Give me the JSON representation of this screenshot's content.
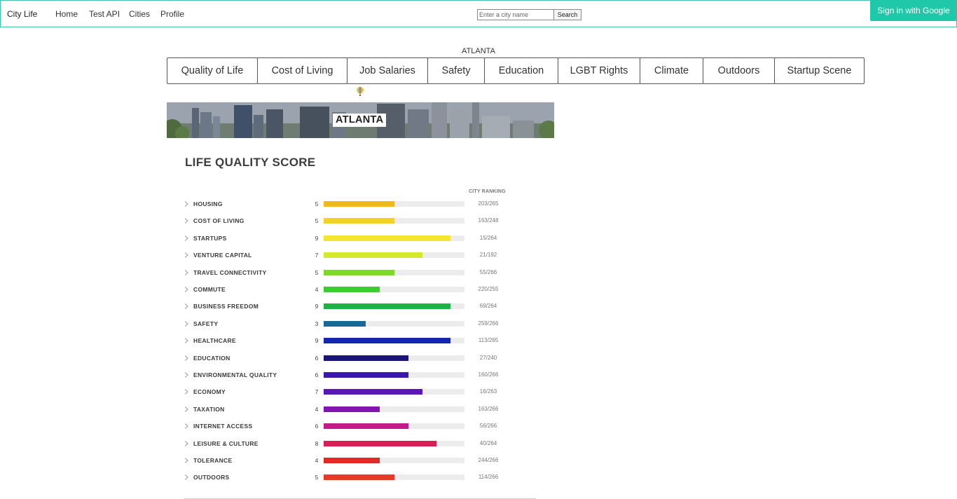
{
  "nav": {
    "brand": "City Life",
    "links": [
      "Home",
      "Test API",
      "Cities",
      "Profile"
    ],
    "search_placeholder": "Enter a city name",
    "search_button": "Search",
    "sign_in": "Sign in with Google"
  },
  "city": {
    "heading": "ATLANTA",
    "banner_label": "ATLANTA"
  },
  "tabs": [
    "Quality of Life",
    "Cost of Living",
    "Job Salaries",
    "Safety",
    "Education",
    "LGBT Rights",
    "Climate",
    "Outdoors",
    "Startup Scene"
  ],
  "scores": {
    "title": "LIFE QUALITY SCORE",
    "rank_header": "CITY RANKING",
    "max_score": 10,
    "rows": [
      {
        "label": "HOUSING",
        "score": 5,
        "rank": "203/265",
        "color": "#f0b81e"
      },
      {
        "label": "COST OF LIVING",
        "score": 5,
        "rank": "163/248",
        "color": "#f3d02a"
      },
      {
        "label": "STARTUPS",
        "score": 9,
        "rank": "15/264",
        "color": "#f4e630"
      },
      {
        "label": "VENTURE CAPITAL",
        "score": 7,
        "rank": "21/192",
        "color": "#d4e92c"
      },
      {
        "label": "TRAVEL CONNECTIVITY",
        "score": 5,
        "rank": "55/266",
        "color": "#7fd92c"
      },
      {
        "label": "COMMUTE",
        "score": 4,
        "rank": "220/255",
        "color": "#3dcc30"
      },
      {
        "label": "BUSINESS FREEDOM",
        "score": 9,
        "rank": "69/264",
        "color": "#1fb048"
      },
      {
        "label": "SAFETY",
        "score": 3,
        "rank": "259/266",
        "color": "#17699a"
      },
      {
        "label": "HEALTHCARE",
        "score": 9,
        "rank": "113/265",
        "color": "#1426b0"
      },
      {
        "label": "EDUCATION",
        "score": 6,
        "rank": "27/240",
        "color": "#1a1578"
      },
      {
        "label": "ENVIRONMENTAL QUALITY",
        "score": 6,
        "rank": "160/266",
        "color": "#3a18b0"
      },
      {
        "label": "ECONOMY",
        "score": 7,
        "rank": "16/263",
        "color": "#5a16b8"
      },
      {
        "label": "TAXATION",
        "score": 4,
        "rank": "163/266",
        "color": "#8316b0"
      },
      {
        "label": "INTERNET ACCESS",
        "score": 6,
        "rank": "56/266",
        "color": "#c21a88"
      },
      {
        "label": "LEISURE & CULTURE",
        "score": 8,
        "rank": "40/264",
        "color": "#d81f55"
      },
      {
        "label": "TOLERANCE",
        "score": 4,
        "rank": "244/266",
        "color": "#e02a28"
      },
      {
        "label": "OUTDOORS",
        "score": 5,
        "rank": "114/266",
        "color": "#e63a26"
      }
    ]
  }
}
